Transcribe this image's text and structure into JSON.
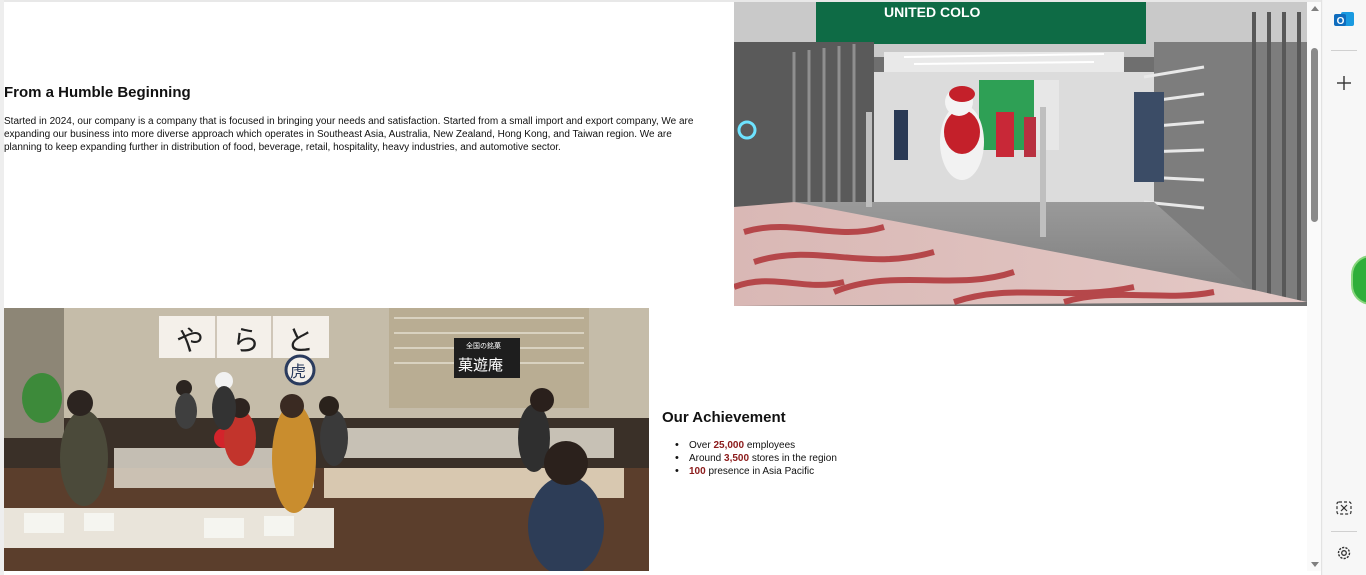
{
  "section1": {
    "title": "From a Humble Beginning",
    "body_line1": "Started in 2024, our company is a company that is focused in bringing your needs and satisfaction. Started from a small import and export company, We are",
    "body_line2": "expanding our business into more diverse approach which operates in Southeast Asia, Australia, New Zealand, Hong Kong, and Taiwan region. We are",
    "body_line3": "planning to keep expanding further in distribution of food, beverage, retail, hospitality, heavy industries, and automotive sector."
  },
  "photo_store": {
    "sign": "UNITED COLO"
  },
  "photo_food": {
    "banner_char1": "や",
    "banner_char2": "ら",
    "banner_char3": "と",
    "shop_sign": "菓遊庵",
    "shop_sign_small": "全国の銘菓",
    "circle_char": "虎"
  },
  "section2": {
    "title": "Our Achievement",
    "items": [
      {
        "pre": "Over ",
        "hl": "25,000",
        "post": " employees"
      },
      {
        "pre": "Around ",
        "hl": "3,500",
        "post": " stores in the region"
      },
      {
        "pre": "",
        "hl": "100",
        "post": " presence in Asia Pacific"
      }
    ]
  },
  "sidebar": {
    "outlook_icon": "outlook-icon",
    "add_icon": "plus-icon",
    "screenshot_icon": "screenshot-icon",
    "settings_icon": "gear-icon"
  },
  "colors": {
    "highlight": "#8b1a1a",
    "store_sign_green": "#0e6b45",
    "carpet_red": "#b5474a"
  }
}
